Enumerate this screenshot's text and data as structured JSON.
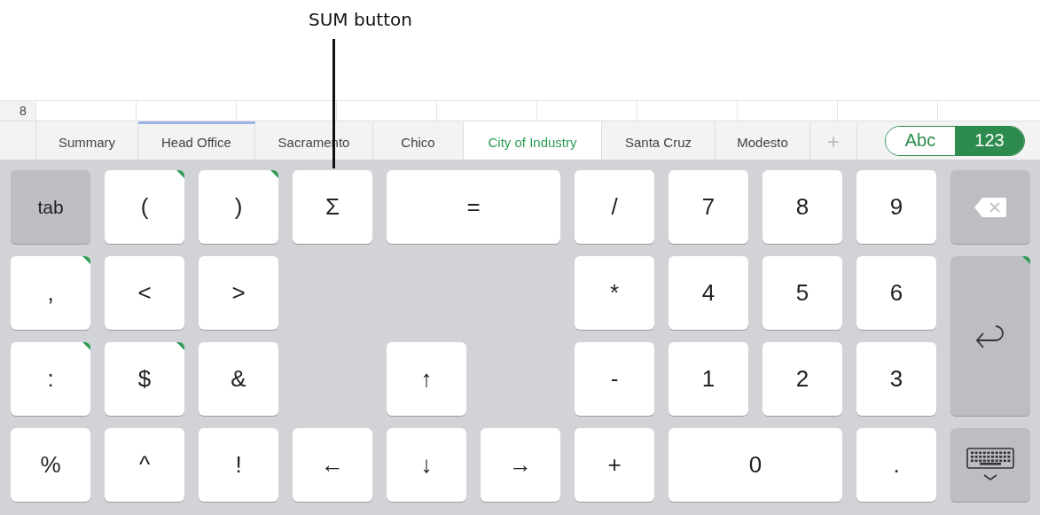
{
  "annotation": {
    "label": "SUM button"
  },
  "sheet": {
    "row_header": "8"
  },
  "tabs": [
    {
      "label": "Summary",
      "selected": false,
      "accent": false
    },
    {
      "label": "Head Office",
      "selected": false,
      "accent": true
    },
    {
      "label": "Sacramento",
      "selected": false,
      "accent": false
    },
    {
      "label": "Chico",
      "selected": false,
      "accent": false
    },
    {
      "label": "City of Industry",
      "selected": true,
      "accent": false
    },
    {
      "label": "Santa Cruz",
      "selected": false,
      "accent": false
    },
    {
      "label": "Modesto",
      "selected": false,
      "accent": false
    }
  ],
  "add_tab": {
    "label": "+"
  },
  "mode_toggle": [
    {
      "label": "Abc",
      "selected": false
    },
    {
      "label": "123",
      "selected": true
    }
  ],
  "keys": [
    {
      "kind": "function",
      "label": "tab",
      "alternates": false
    },
    {
      "kind": "char",
      "label": "(",
      "alternates": true
    },
    {
      "kind": "char",
      "label": ")",
      "alternates": true
    },
    {
      "kind": "char",
      "label": "Σ",
      "alternates": false
    },
    {
      "kind": "char",
      "label": "=",
      "alternates": false
    },
    {
      "kind": "char",
      "label": "/",
      "alternates": false
    },
    {
      "kind": "char",
      "label": "7",
      "alternates": false
    },
    {
      "kind": "char",
      "label": "8",
      "alternates": false
    },
    {
      "kind": "char",
      "label": "9",
      "alternates": false
    },
    {
      "kind": "backspace",
      "alternates": false
    },
    {
      "kind": "char",
      "label": ",",
      "alternates": true
    },
    {
      "kind": "char",
      "label": "<",
      "alternates": false
    },
    {
      "kind": "char",
      "label": ">",
      "alternates": false
    },
    {
      "kind": "char",
      "label": "*",
      "alternates": false
    },
    {
      "kind": "char",
      "label": "4",
      "alternates": false
    },
    {
      "kind": "char",
      "label": "5",
      "alternates": false
    },
    {
      "kind": "char",
      "label": "6",
      "alternates": false
    },
    {
      "kind": "return",
      "alternates": true
    },
    {
      "kind": "char",
      "label": ":",
      "alternates": true
    },
    {
      "kind": "char",
      "label": "$",
      "alternates": true
    },
    {
      "kind": "char",
      "label": "&",
      "alternates": false
    },
    {
      "kind": "char",
      "label": "↑",
      "alternates": false
    },
    {
      "kind": "char",
      "label": "-",
      "alternates": false
    },
    {
      "kind": "char",
      "label": "1",
      "alternates": false
    },
    {
      "kind": "char",
      "label": "2",
      "alternates": false
    },
    {
      "kind": "char",
      "label": "3",
      "alternates": false
    },
    {
      "kind": "char",
      "label": "%",
      "alternates": false
    },
    {
      "kind": "char",
      "label": "^",
      "alternates": false
    },
    {
      "kind": "char",
      "label": "!",
      "alternates": false
    },
    {
      "kind": "char",
      "label": "←",
      "alternates": false
    },
    {
      "kind": "char",
      "label": "↓",
      "alternates": false
    },
    {
      "kind": "char",
      "label": "→",
      "alternates": false
    },
    {
      "kind": "char",
      "label": "+",
      "alternates": false
    },
    {
      "kind": "char",
      "label": "0",
      "alternates": false
    },
    {
      "kind": "char",
      "label": ".",
      "alternates": false
    },
    {
      "kind": "hide",
      "alternates": false
    }
  ]
}
